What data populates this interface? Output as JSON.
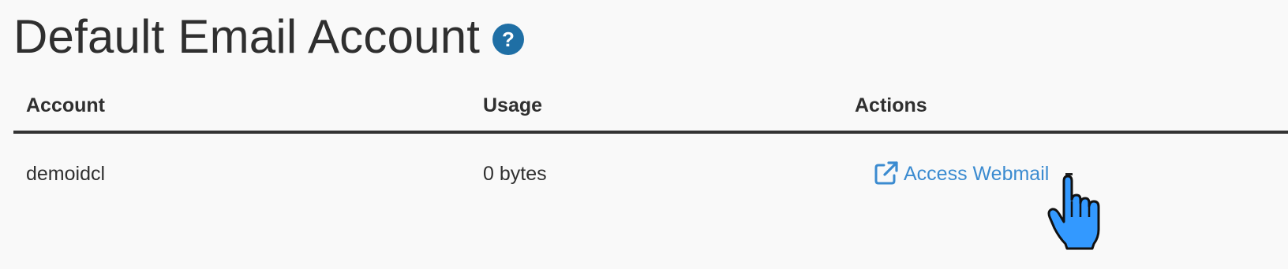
{
  "header": {
    "title": "Default Email Account",
    "help_icon": "question-circle-icon"
  },
  "table": {
    "columns": [
      "Account",
      "Usage",
      "Actions"
    ],
    "rows": [
      {
        "account": "demoidcl",
        "usage": "0 bytes",
        "action_label": "Access Webmail",
        "action_icon": "external-link-icon"
      }
    ]
  },
  "cursor": {
    "icon": "hand-pointer-cursor-icon"
  },
  "colors": {
    "title": "#2f2f2f",
    "help_icon_bg": "#1f6fa5",
    "link": "#3b8bd0",
    "header_rule": "#333333",
    "background": "#f9f9f9",
    "cursor_fill": "#3399ff"
  }
}
